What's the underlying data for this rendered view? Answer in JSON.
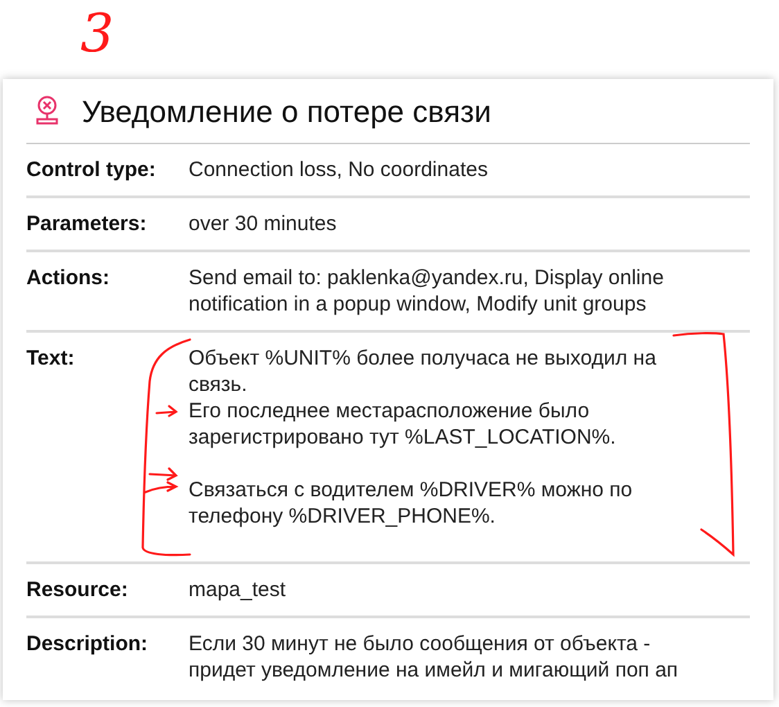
{
  "annotation": {
    "label": "3"
  },
  "popup": {
    "title": "Уведомление о потере связи",
    "rows": [
      {
        "label": "Control type:",
        "value": "Connection loss, No coordinates"
      },
      {
        "label": "Parameters:",
        "value": "over 30 minutes"
      },
      {
        "label": "Actions:",
        "value": "Send email to: paklenka@yandex.ru, Display online notification in a popup window, Modify unit groups"
      },
      {
        "label": "Text:",
        "value": "Объект %UNIT% более получаса не выходил на связь.\nЕго последнее местарасположение было зарегистрировано тут %LAST_LOCATION%.\n\nСвязаться с водителем %DRIVER% можно по телефону %DRIVER_PHONE%."
      },
      {
        "label": "Resource:",
        "value": "mapa_test"
      },
      {
        "label": "Description:",
        "value": "Если 30 минут не было сообщения от объекта - придет уведомление на имейл и мигающий поп ап"
      }
    ]
  }
}
